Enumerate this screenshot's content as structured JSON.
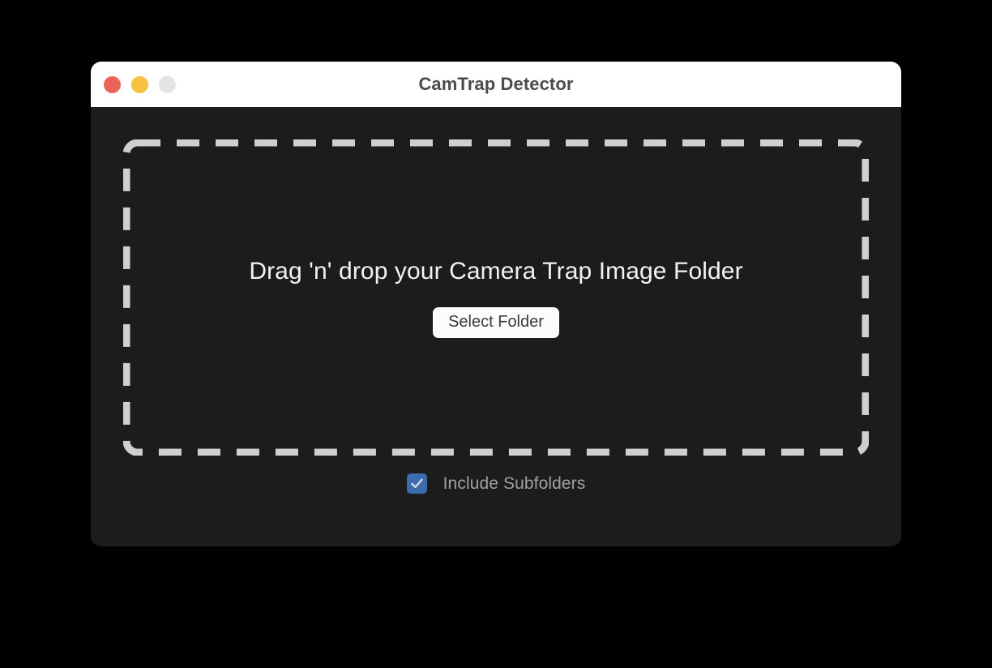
{
  "window": {
    "title": "CamTrap Detector",
    "controls": [
      {
        "name": "close",
        "label": "Close",
        "color": "#ea6459"
      },
      {
        "name": "minimize",
        "label": "Minimize",
        "color": "#f5c242"
      },
      {
        "name": "zoom",
        "label": "Zoom",
        "color": "#e3e3e3"
      }
    ],
    "background": "#1c1c1c",
    "titlebar_background": "#ffffff",
    "title_color": "#4b4b4b"
  },
  "dropzone": {
    "headline": "Drag 'n' drop your Camera Trap Image Folder",
    "button_label": "Select Folder",
    "border_color": "#cfcfcf",
    "headline_color": "#f2f2f2",
    "button_background": "#fcfcfc",
    "button_text_color": "#3b3b3b"
  },
  "options": {
    "include_subfolders": {
      "label": "Include Subfolders",
      "checked": true,
      "accent_color": "#3c6cb0",
      "label_color": "#a0a0a0"
    }
  },
  "page": {
    "background": "#000000"
  }
}
